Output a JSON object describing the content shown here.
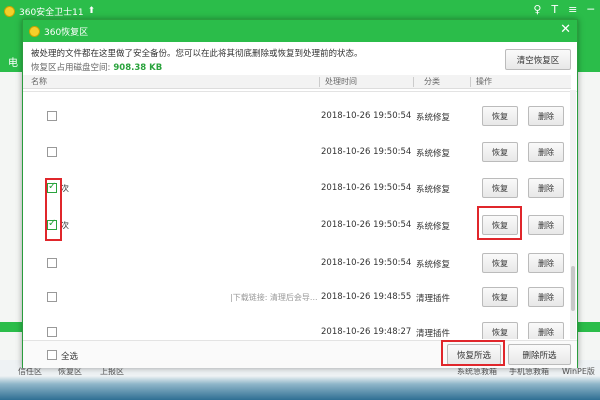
{
  "app": {
    "title": "360安全卫士11",
    "up_icon": "up-arrow-icon",
    "side_label": "电",
    "title_icons": [
      "user-icon",
      "shirt-icon",
      "menu-icon",
      "minimize-icon"
    ],
    "title_icon_glyphs": [
      "♀",
      "T",
      "≡",
      "─"
    ]
  },
  "bottom_tools": {
    "left": [
      "信任区",
      "恢复区",
      "上报区"
    ],
    "right": [
      "系统急救箱",
      "手机急救箱",
      "WinPE版"
    ]
  },
  "dialog": {
    "title": "360恢复区",
    "close_glyph": "✕",
    "info_text": "被处理的文件都在这里做了安全备份。您可以在此将其彻底删除或恢复到处理前的状态。",
    "space_label": "恢复区占用磁盘空间:",
    "space_value": "908.38 KB",
    "clear_button": "清空恢复区",
    "columns": {
      "name": "名称",
      "time": "处理时间",
      "category": "分类",
      "action": "操作"
    },
    "restore_label": "恢复",
    "delete_label": "删除",
    "rows": [
      {
        "name": "",
        "time": "2018-10-26 19:50:54",
        "category": "系统修复",
        "note": ""
      },
      {
        "name": "",
        "time": "2018-10-26 19:50:54",
        "category": "系统修复",
        "note": ""
      },
      {
        "name": "次",
        "time": "2018-10-26 19:50:54",
        "category": "系统修复",
        "note": ""
      },
      {
        "name": "次",
        "time": "2018-10-26 19:50:54",
        "category": "系统修复",
        "note": ""
      },
      {
        "name": "",
        "time": "2018-10-26 19:50:54",
        "category": "系统修复",
        "note": ""
      },
      {
        "name": "",
        "time": "2018-10-26 19:48:55",
        "category": "清理插件",
        "note": "|下载链接: 清理后会导..."
      },
      {
        "name": "",
        "time": "2018-10-26 19:48:27",
        "category": "清理插件",
        "note": ""
      }
    ],
    "checked_rows": [
      2,
      3
    ],
    "select_all_label": "全选",
    "restore_selected": "恢复所选",
    "delete_selected": "删除所选"
  },
  "highlight_color": "#e0262b",
  "accent_color": "#2bbd4a"
}
